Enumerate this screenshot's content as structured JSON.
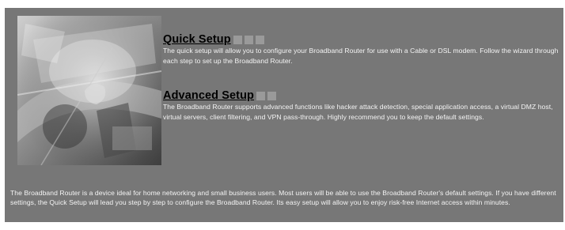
{
  "quick_setup": {
    "title": "Quick Setup",
    "description": "The quick setup will allow you to configure your Broadband Router for use with a Cable or DSL modem. Follow the wizard through each step to set up the Broadband Router."
  },
  "advanced_setup": {
    "title": "Advanced Setup",
    "description": "The Broadband Router supports advanced functions like hacker attack detection, special application access, a virtual DMZ host, virtual servers, client filtering, and VPN pass-through. Highly recommend you to keep the default settings."
  },
  "footer": {
    "text": "The Broadband Router is a device ideal for home networking and small business users. Most users will be able to use the Broadband Router's default settings. If you have different settings, the Quick Setup will lead you step by step to configure the Broadband Router. Its easy setup will allow you to enjoy risk-free Internet access within minutes."
  },
  "colors": {
    "panel_background": "#777777",
    "heading": "#000000",
    "body_text": "#ffffff",
    "decor_square": "#9a9a9a"
  },
  "icons": {
    "hero": "network-collage-image",
    "bullet": "grey-square-icon"
  }
}
